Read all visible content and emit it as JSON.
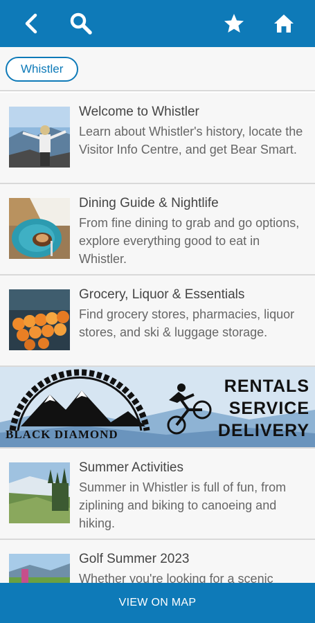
{
  "header": {
    "back_icon": "chevron-left-icon",
    "search_icon": "search-icon",
    "favorite_icon": "star-icon",
    "home_icon": "home-icon",
    "color": "#0e7ab8"
  },
  "filter": {
    "chip_label": "Whistler"
  },
  "items": [
    {
      "title": "Welcome to Whistler",
      "description": "Learn about Whistler's history, locate the Visitor Info Centre, and get Bear Smart."
    },
    {
      "title": "Dining Guide & Nightlife",
      "description": "From fine dining to grab and go options, explore everything good to eat in Whistler."
    },
    {
      "title": "Grocery, Liquor & Essentials",
      "description": "Find grocery stores, pharmacies, liquor stores, and ski & luggage storage."
    },
    {
      "title": "Summer Activities",
      "description": "Summer in Whistler is full of fun, from ziplining and biking to canoeing and hiking."
    },
    {
      "title": "Golf Summer 2023",
      "description": "Whether you're looking for a scenic"
    }
  ],
  "banner": {
    "brand": "BLACK DIAMOND",
    "line1": "RENTALS",
    "line2": "SERVICE",
    "line3": "DELIVERY"
  },
  "footer": {
    "map_button": "VIEW ON MAP"
  }
}
